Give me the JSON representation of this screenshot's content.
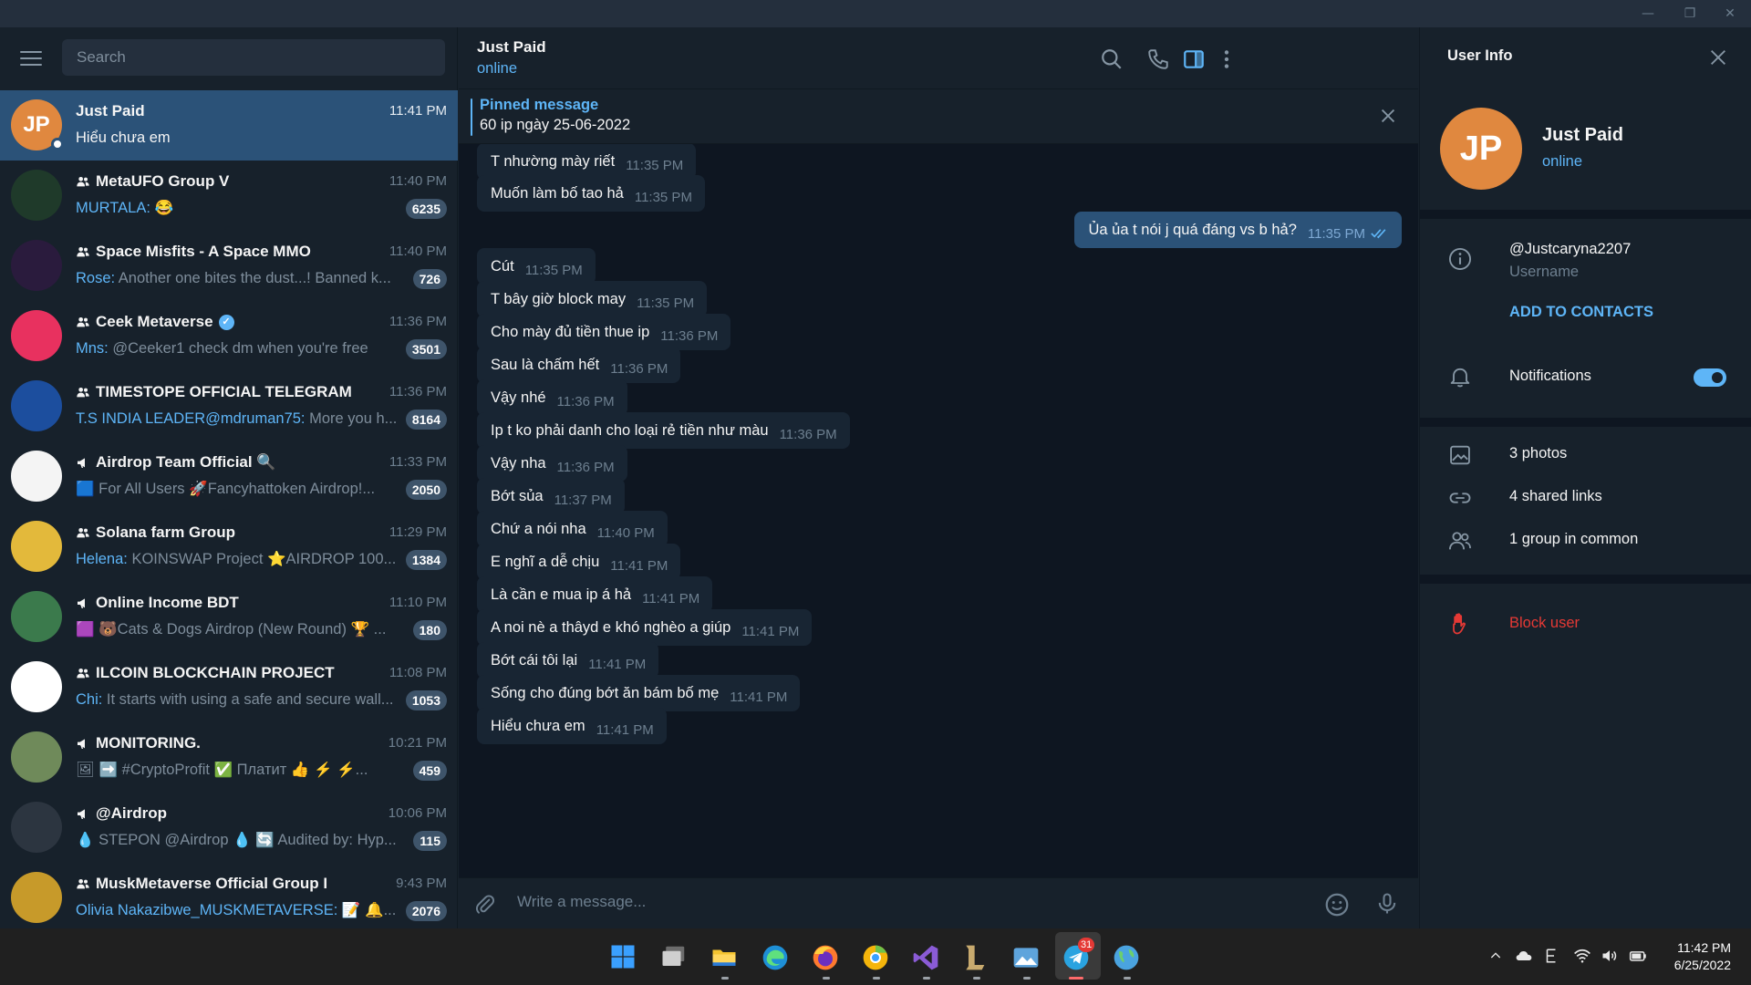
{
  "window": {
    "minimize": "—",
    "restore": "❐",
    "close": "✕"
  },
  "sidebar": {
    "search_placeholder": "Search",
    "chats": [
      {
        "name": "Just Paid",
        "time": "11:41 PM",
        "sender": "",
        "preview": "Hiểu chưa em",
        "badge": "",
        "initials": "JP",
        "color": "#e0883f",
        "type": "user",
        "active": true
      },
      {
        "name": "MetaUFO Group V",
        "time": "11:40 PM",
        "sender": "MURTALA:",
        "preview": " 😂",
        "badge": "6235",
        "color": "#1f3a2a",
        "type": "group"
      },
      {
        "name": "Space Misfits - A Space MMO",
        "time": "11:40 PM",
        "sender": "Rose:",
        "preview": " Another one bites the dust...! Banned k...",
        "badge": "726",
        "color": "#2a1b3d",
        "type": "group"
      },
      {
        "name": "Ceek Metaverse",
        "time": "11:36 PM",
        "sender": "Mns:",
        "preview": " @Ceeker1 check dm when you're free",
        "badge": "3501",
        "color": "#e8315f",
        "type": "group",
        "verified": true
      },
      {
        "name": "TIMESTOPE OFFICIAL TELEGRAM",
        "time": "11:36 PM",
        "sender": "T.S INDIA LEADER@mdruman75:",
        "preview": " More you h...",
        "badge": "8164",
        "color": "#1c4e9e",
        "type": "group"
      },
      {
        "name": "Airdrop Team Official 🔍",
        "time": "11:33 PM",
        "sender": "",
        "preview": "🟦 For All Users  🚀Fancyhattoken Airdrop!...",
        "badge": "2050",
        "color": "#f4f4f4",
        "type": "channel"
      },
      {
        "name": "Solana farm Group",
        "time": "11:29 PM",
        "sender": "Helena:",
        "preview": " KOINSWAP Project  ⭐AIRDROP 100...",
        "badge": "1384",
        "color": "#e3b93b",
        "type": "group"
      },
      {
        "name": "Online Income BDT",
        "time": "11:10 PM",
        "sender": "",
        "preview": "🟪 🐻Cats & Dogs Airdrop (New Round) 🏆 ...",
        "badge": "180",
        "color": "#3b7a4c",
        "type": "channel"
      },
      {
        "name": "ILCOIN BLOCKCHAIN PROJECT",
        "time": "11:08 PM",
        "sender": "Chi:",
        "preview": " It starts with using a safe and secure wall...",
        "badge": "1053",
        "color": "#ffffff",
        "type": "group"
      },
      {
        "name": "MONITORING.",
        "time": "10:21 PM",
        "sender": "",
        "preview": "🖼 ➡️ #CryptoProfit ✅ Платит 👍 ⚡ ⚡...",
        "badge": "459",
        "color": "#6f8a5a",
        "type": "channel"
      },
      {
        "name": "@Airdrop",
        "time": "10:06 PM",
        "sender": "",
        "preview": "💧 STEPON @Airdrop 💧 🔄 Audited by: Hyp...",
        "badge": "115",
        "color": "#2c3540",
        "type": "channel"
      },
      {
        "name": "MuskMetaverse Official Group I",
        "time": "9:43 PM",
        "sender": "Olivia Nakazibwe_MUSKMETAVERSE:",
        "preview": " 📝 🔔...",
        "badge": "2076",
        "color": "#c79a2a",
        "type": "group"
      }
    ]
  },
  "chat": {
    "title": "Just Paid",
    "status": "online",
    "pinned_title": "Pinned message",
    "pinned_text": "60 ip ngày 25-06-2022",
    "messages": [
      {
        "text": "T nhường mày riết",
        "time": "11:35 PM",
        "out": false
      },
      {
        "text": "Muốn làm bố tao hả",
        "time": "11:35 PM",
        "out": false
      },
      {
        "text": "Ủa ủa t nói j quá đáng vs b hả?",
        "time": "11:35 PM",
        "out": true
      },
      {
        "text": "Cút",
        "time": "11:35 PM",
        "out": false
      },
      {
        "text": "T bây giờ block may",
        "time": "11:35 PM",
        "out": false
      },
      {
        "text": "Cho mày đủ tiền thue ip",
        "time": "11:36 PM",
        "out": false
      },
      {
        "text": "Sau là chấm hết",
        "time": "11:36 PM",
        "out": false
      },
      {
        "text": "Vậy nhé",
        "time": "11:36 PM",
        "out": false
      },
      {
        "text": "Ip t ko phải danh cho loại rẻ tiền như màu",
        "time": "11:36 PM",
        "out": false
      },
      {
        "text": "Vậy nha",
        "time": "11:36 PM",
        "out": false
      },
      {
        "text": "Bớt sủa",
        "time": "11:37 PM",
        "out": false
      },
      {
        "text": "Chứ a nói nha",
        "time": "11:40 PM",
        "out": false
      },
      {
        "text": "E nghĩ a dễ chịu",
        "time": "11:41 PM",
        "out": false
      },
      {
        "text": "Là cần e mua ip á hả",
        "time": "11:41 PM",
        "out": false
      },
      {
        "text": "A noi nè a thâyd e khó nghèo a giúp",
        "time": "11:41 PM",
        "out": false
      },
      {
        "text": "Bớt cái tôi lại",
        "time": "11:41 PM",
        "out": false
      },
      {
        "text": "Sống cho đúng bớt ăn bám bố mẹ",
        "time": "11:41 PM",
        "out": false
      },
      {
        "text": "Hiểu chưa em",
        "time": "11:41 PM",
        "out": false
      }
    ],
    "composer_placeholder": "Write a message..."
  },
  "user_info": {
    "header": "User Info",
    "initials": "JP",
    "name": "Just Paid",
    "status": "online",
    "username": "@Justcaryna2207",
    "username_label": "Username",
    "add_contacts": "ADD TO CONTACTS",
    "notifications": "Notifications",
    "notifications_on": true,
    "photos": "3 photos",
    "links": "4 shared links",
    "groups": "1 group in common",
    "block": "Block user",
    "accent": "#5eb5f7",
    "danger": "#e53935"
  },
  "taskbar": {
    "apps": [
      "windows-start",
      "task-view",
      "file-explorer",
      "edge",
      "firefox",
      "chrome-canary",
      "visual-studio",
      "league-of-legends",
      "photos",
      "telegram",
      "earth-app"
    ],
    "telegram_badge": "31",
    "time": "11:42 PM",
    "date": "6/25/2022"
  }
}
